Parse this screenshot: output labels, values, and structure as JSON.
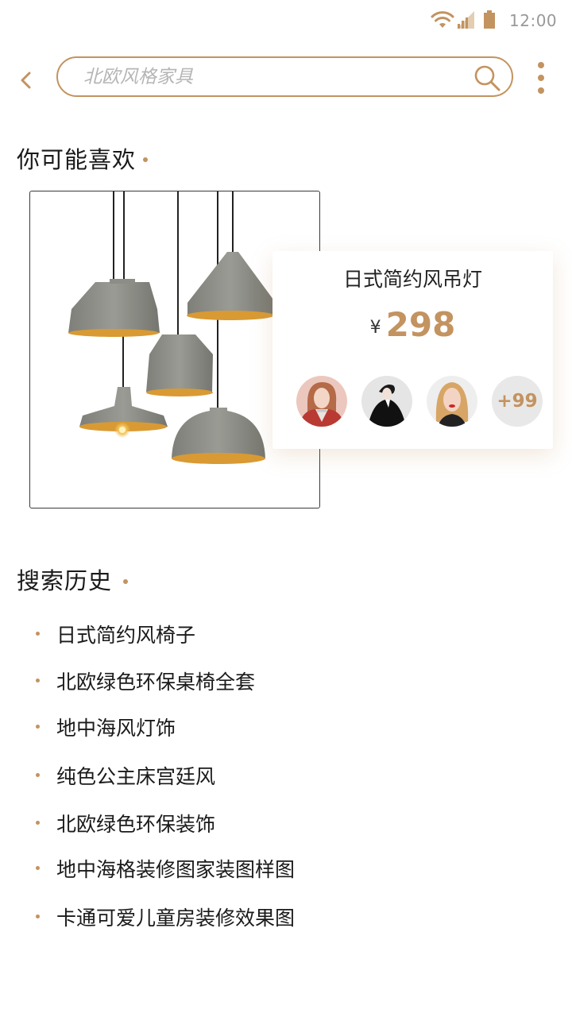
{
  "status_bar": {
    "time": "12:00",
    "icons": [
      "wifi-icon",
      "signal-icon",
      "battery-icon"
    ]
  },
  "header": {
    "back_icon": "chevron-left-icon",
    "search_placeholder": "北欧风格家具",
    "search_icon": "search-icon",
    "more_icon": "more-vertical-icon"
  },
  "recommend": {
    "title": "你可能喜欢",
    "product": {
      "image": "pendant-lamps-image",
      "name": "日式简约风吊灯",
      "currency": "¥",
      "price": "298",
      "avatars": [
        "avatar-user-1",
        "avatar-user-2",
        "avatar-user-3"
      ],
      "more_count": "+99"
    }
  },
  "history": {
    "title": "搜索历史",
    "items": [
      "日式简约风椅子",
      "北欧绿色环保桌椅全套",
      "地中海风灯饰",
      "纯色公主床宫廷风",
      "北欧绿色环保装饰",
      "地中海格装修图家装图样图",
      "卡通可爱儿童房装修效果图"
    ]
  },
  "colors": {
    "accent": "#c39360",
    "text": "#1a1a1a",
    "placeholder": "#b5b5b5",
    "status": "#999999"
  }
}
